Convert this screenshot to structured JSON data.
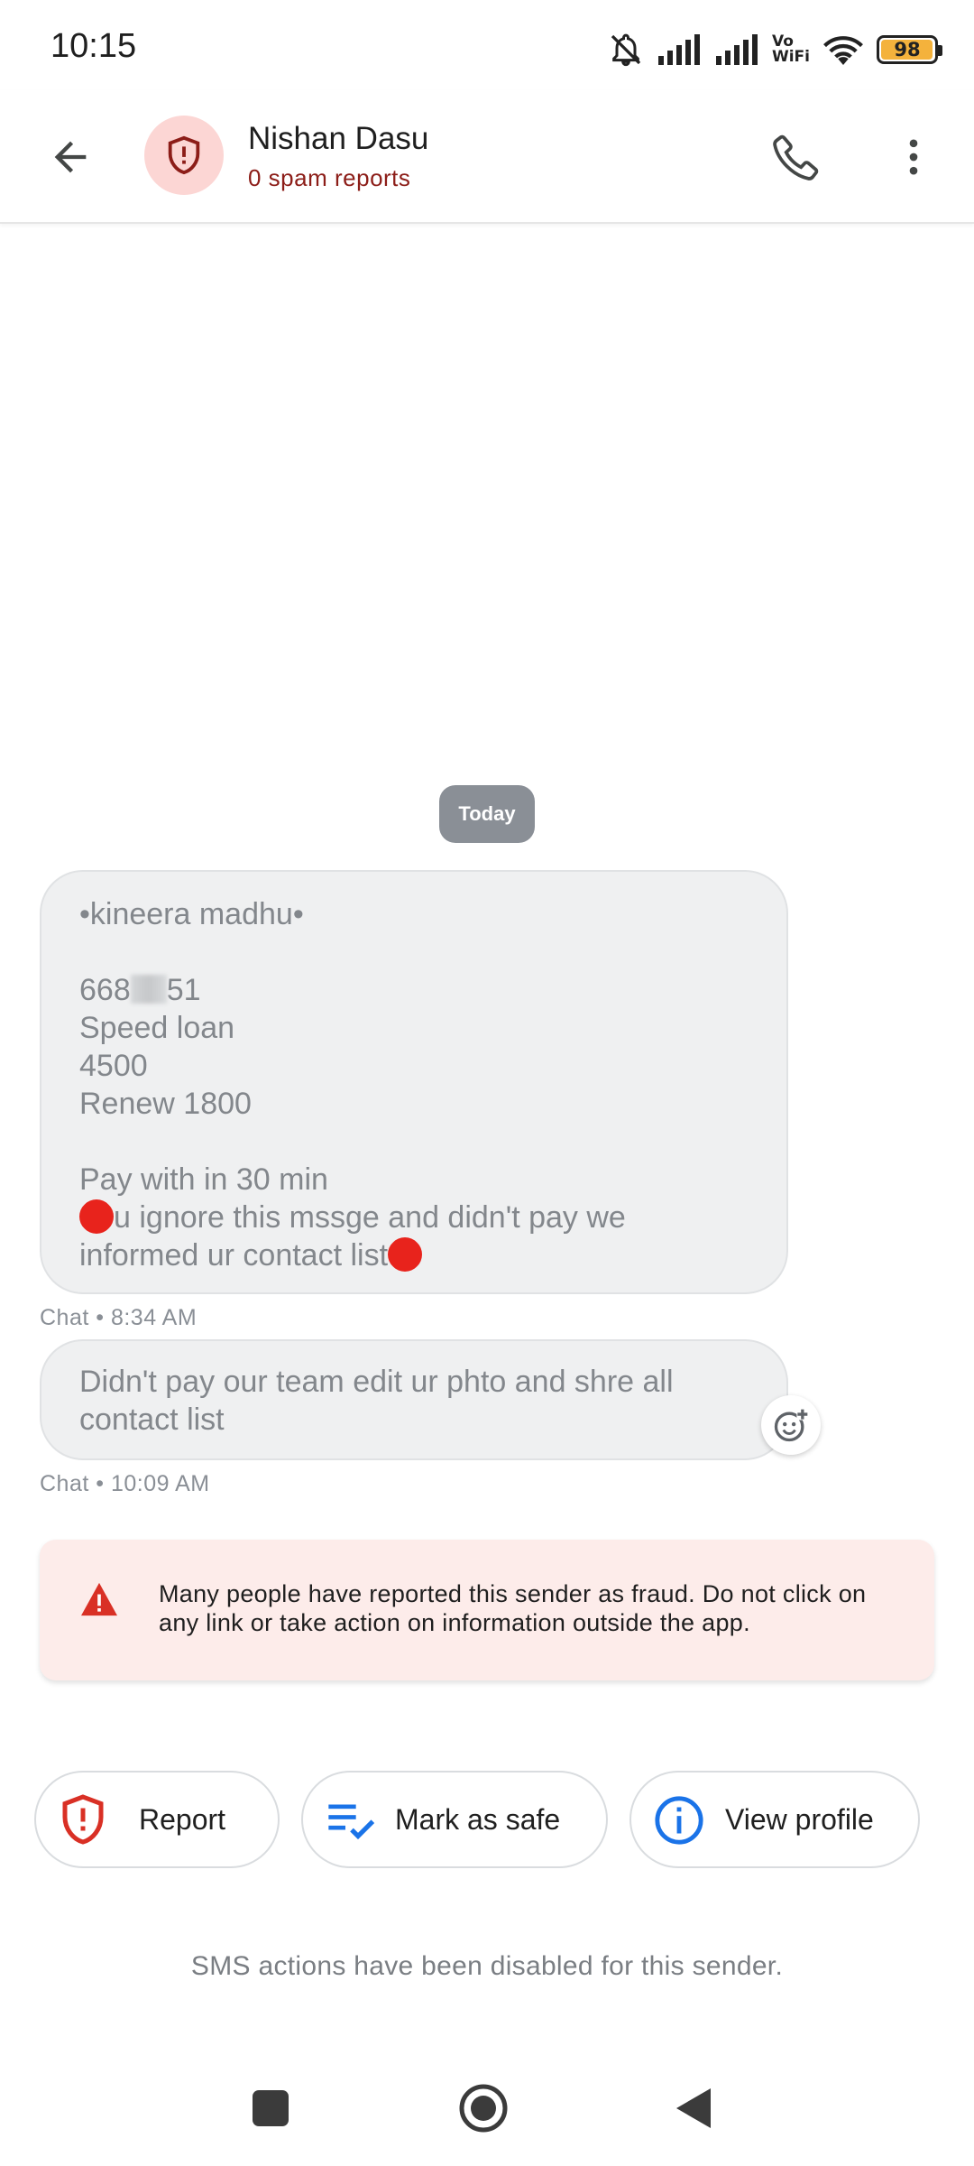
{
  "status_bar": {
    "time": "10:15",
    "vowifi_line1": "Vo",
    "vowifi_line2": "WiFi",
    "battery_percent": 98,
    "battery_text": "98",
    "icons": [
      "bell-off-icon",
      "signal-icon",
      "signal-icon",
      "vowifi-icon",
      "wifi-icon",
      "battery-icon"
    ]
  },
  "app_bar": {
    "back_icon": "arrow-left-icon",
    "avatar_icon": "shield-alert-icon",
    "contact_name": "Nishan Dasu",
    "spam_reports": "0 spam reports",
    "call_icon": "phone-icon",
    "more_icon": "more-vert-icon"
  },
  "conversation": {
    "date_chip": "Today",
    "messages": [
      {
        "line1": "•kineera madhu•",
        "line2a": "668",
        "line2b": "51",
        "line3": "Speed loan",
        "line4": "4500",
        "line5": "Renew 1800",
        "line6": "Pay with in 30 min",
        "line7": "u ignore this mssge and didn't pay we",
        "line8": "informed ur contact list",
        "meta": "Chat • 8:34 AM"
      },
      {
        "text": "Didn't pay our team edit ur phto and shre all contact list",
        "meta": "Chat • 10:09 AM"
      }
    ],
    "react_icon": "add-reaction-icon"
  },
  "warning": {
    "icon": "warning-triangle-icon",
    "text": "Many people have reported this sender as fraud. Do not click on any link or take action on information outside the app."
  },
  "actions": {
    "report_label": "Report",
    "mark_safe_label": "Mark as safe",
    "view_profile_label": "View profile"
  },
  "footer_note": "SMS actions have been disabled for this sender.",
  "colors": {
    "spam_red": "#8c1d18",
    "avatar_bg": "#fcd6d4",
    "warning_bg": "#fdecea",
    "report_red": "#d93025",
    "blue": "#1a73e8",
    "bubble_bg": "#eff0f1"
  }
}
